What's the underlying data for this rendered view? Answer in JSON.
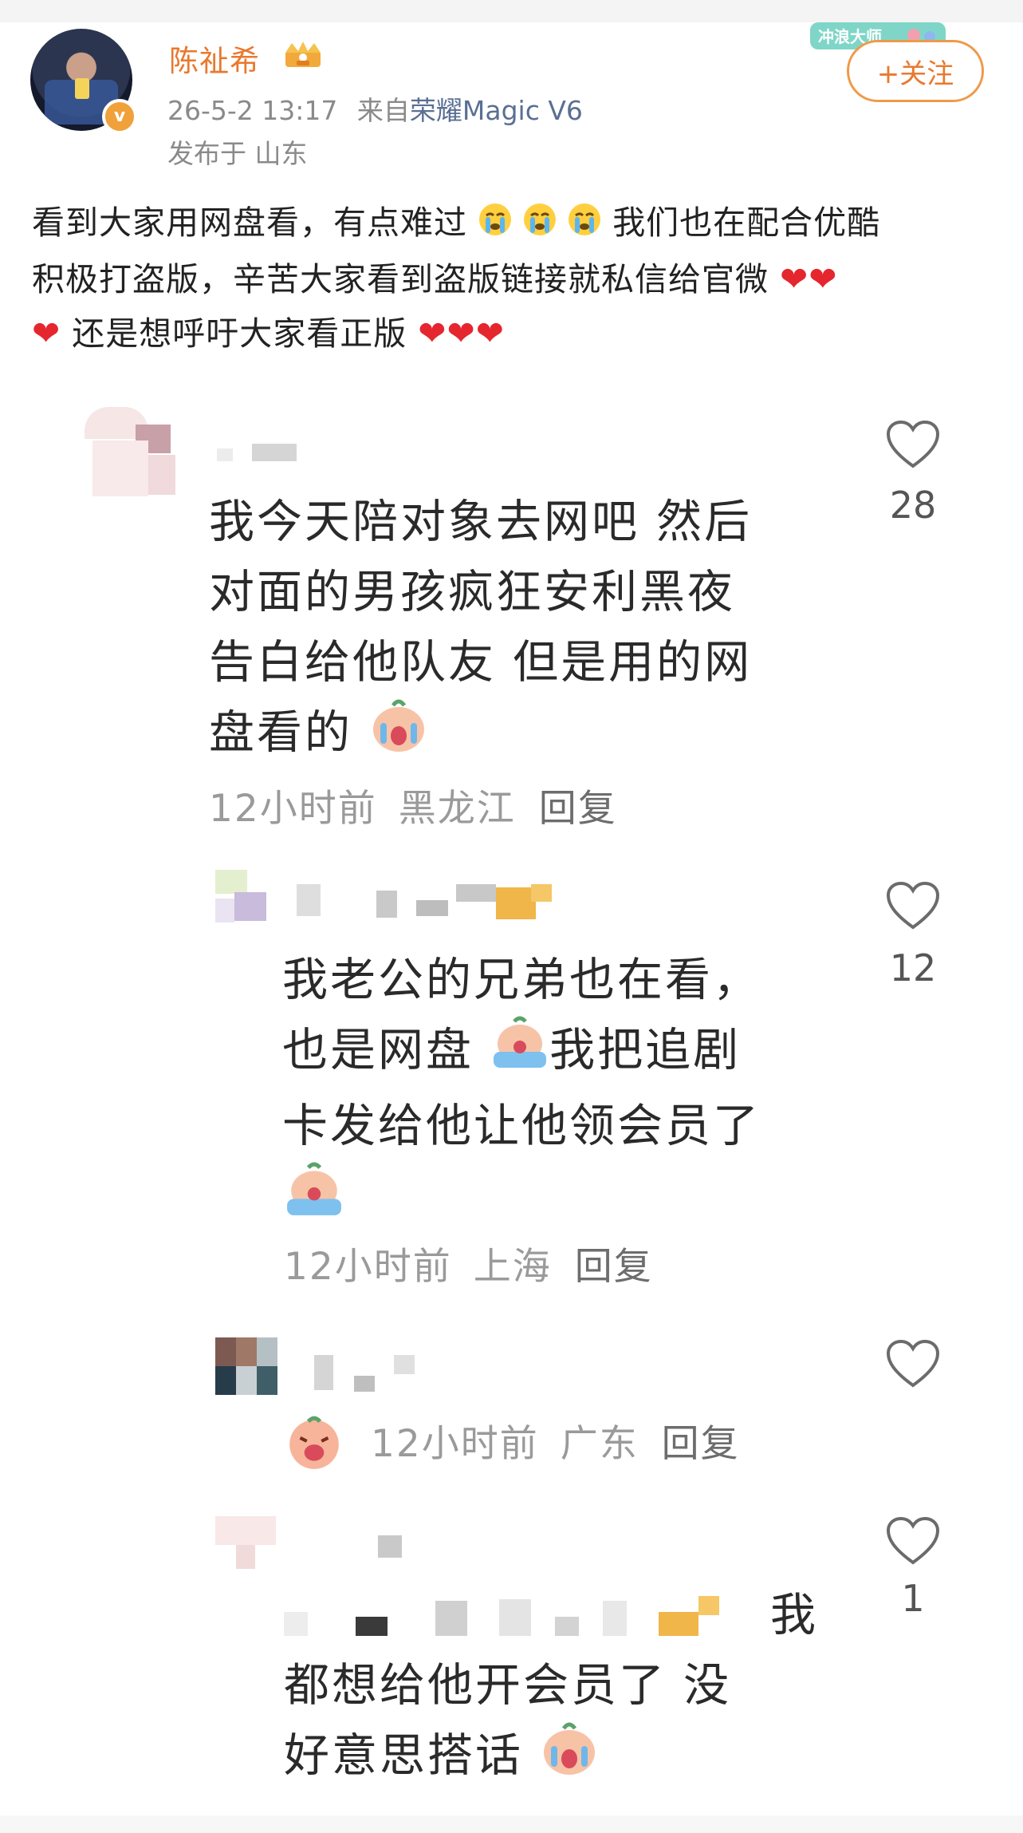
{
  "post": {
    "author": "陈祉希",
    "time": "26-5-2 13:17",
    "source_prefix": "来自",
    "device": "荣耀Magic V6",
    "location": "发布于 山东",
    "follow_label": "+关注",
    "surf_badge": "冲浪大师",
    "text_line1": "看到大家用网盘看，有点难过",
    "text_line1b": "我们也在配合优酷",
    "text_line2": "积极打盗版，辛苦大家看到盗版链接就私信给官微",
    "text_line3": "还是想呼吁大家看正版"
  },
  "comments": [
    {
      "lines": [
        "我今天陪对象去网吧 然后",
        "对面的男孩疯狂安利黑夜",
        "告白给他队友 但是用的网",
        "盘看的"
      ],
      "meta_time": "12小时前",
      "meta_loc": "黑龙江",
      "reply": "回复",
      "likes": "28"
    },
    {
      "lines": [
        "我老公的兄弟也在看，",
        "也是网盘",
        "我把追剧",
        "卡发给他让他领会员了"
      ],
      "meta_time": "12小时前",
      "meta_loc": "上海",
      "reply": "回复",
      "likes": "12"
    },
    {
      "meta_time": "12小时前",
      "meta_loc": "广东",
      "reply": "回复",
      "likes": ""
    },
    {
      "lines": [
        "我",
        "都想给他开会员了 没",
        "好意思搭话"
      ],
      "likes": "1"
    }
  ],
  "colors": {
    "username": "#e8792e",
    "follow_border": "#ee9a4a",
    "heart_emoji": "#e5262f",
    "meta_gray": "#9a9a9a"
  },
  "icons": [
    "heart-outline-icon",
    "crying-emoji",
    "red-heart-emoji",
    "crown-icon",
    "verified-badge-icon"
  ]
}
